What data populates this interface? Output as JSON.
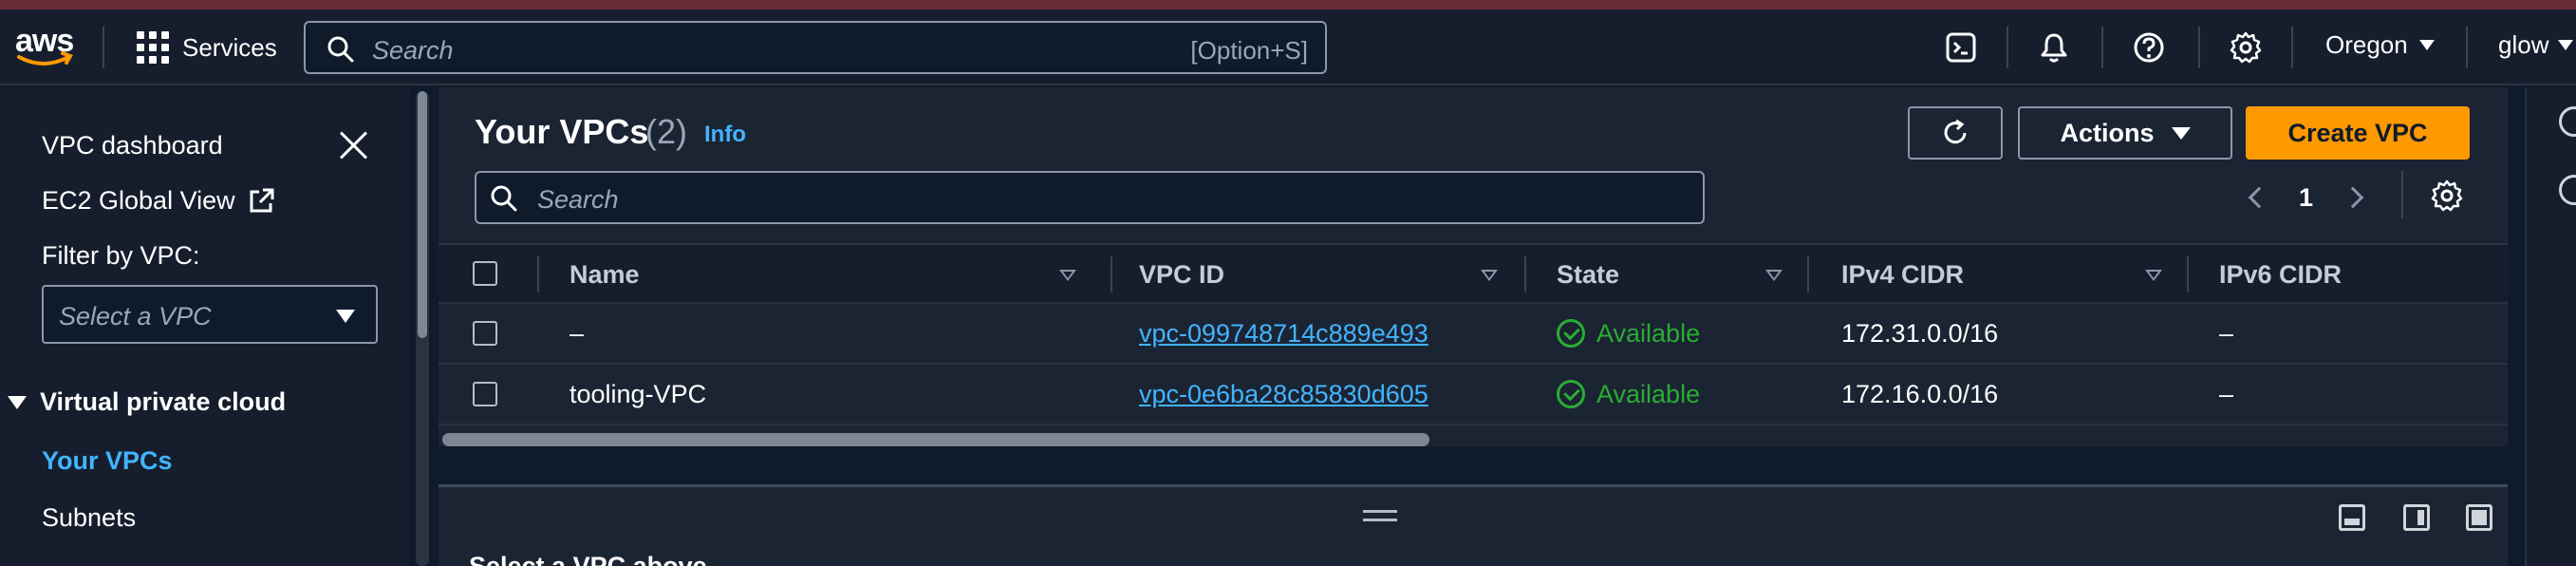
{
  "header": {
    "logo": "aws",
    "services_label": "Services",
    "search_placeholder": "Search",
    "search_shortcut": "[Option+S]",
    "icons": [
      "cloudshell-icon",
      "bell-icon",
      "help-icon",
      "gear-icon"
    ],
    "region": "Oregon",
    "user": "glow"
  },
  "sidebar": {
    "dashboard": "VPC dashboard",
    "ec2_global": "EC2 Global View",
    "filter_label": "Filter by VPC:",
    "filter_placeholder": "Select a VPC",
    "section": "Virtual private cloud",
    "items": [
      {
        "label": "Your VPCs",
        "active": true
      },
      {
        "label": "Subnets",
        "active": false
      }
    ]
  },
  "main": {
    "title": "Your VPCs",
    "count": "(2)",
    "info": "Info",
    "actions_label": "Actions",
    "create_label": "Create VPC",
    "search_placeholder": "Search",
    "page": "1",
    "columns": [
      "Name",
      "VPC ID",
      "State",
      "IPv4 CIDR",
      "IPv6 CIDR"
    ],
    "rows": [
      {
        "name": "–",
        "vpc_id": "vpc-099748714c889e493",
        "state": "Available",
        "ipv4": "172.31.0.0/16",
        "ipv6": "–"
      },
      {
        "name": "tooling-VPC",
        "vpc_id": "vpc-0e6ba28c85830d605",
        "state": "Available",
        "ipv4": "172.16.0.0/16",
        "ipv6": "–"
      }
    ],
    "split_text": "Select a VPC above"
  },
  "colors": {
    "accent": "#42b4ff",
    "primary_button": "#ff9900",
    "status_ok": "#29ad32",
    "background": "#0f1b2a"
  }
}
